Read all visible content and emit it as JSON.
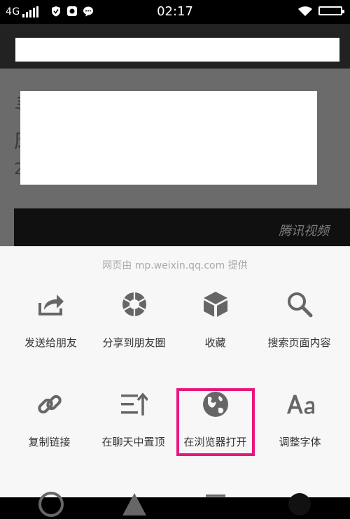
{
  "status_bar": {
    "carrier": "4G",
    "time": "02:17"
  },
  "article": {
    "peek_chars": [
      "寻",
      "床",
      "2"
    ],
    "video_watermark": "腾讯视频"
  },
  "menu": {
    "provider": "网页由 mp.weixin.qq.com 提供",
    "row1": [
      {
        "label": "发送给朋友",
        "icon": "share-arrow-icon"
      },
      {
        "label": "分享到朋友圈",
        "icon": "moments-shutter-icon"
      },
      {
        "label": "收藏",
        "icon": "favorite-cube-icon"
      },
      {
        "label": "搜索页面内容",
        "icon": "search-icon"
      }
    ],
    "row2": [
      {
        "label": "复制链接",
        "icon": "link-icon"
      },
      {
        "label": "在聊天中置顶",
        "icon": "pin-to-top-icon"
      },
      {
        "label": "在浏览器打开",
        "icon": "globe-icon"
      },
      {
        "label": "调整字体",
        "icon": "font-size-icon"
      }
    ],
    "highlight_color": "#e8177e"
  }
}
